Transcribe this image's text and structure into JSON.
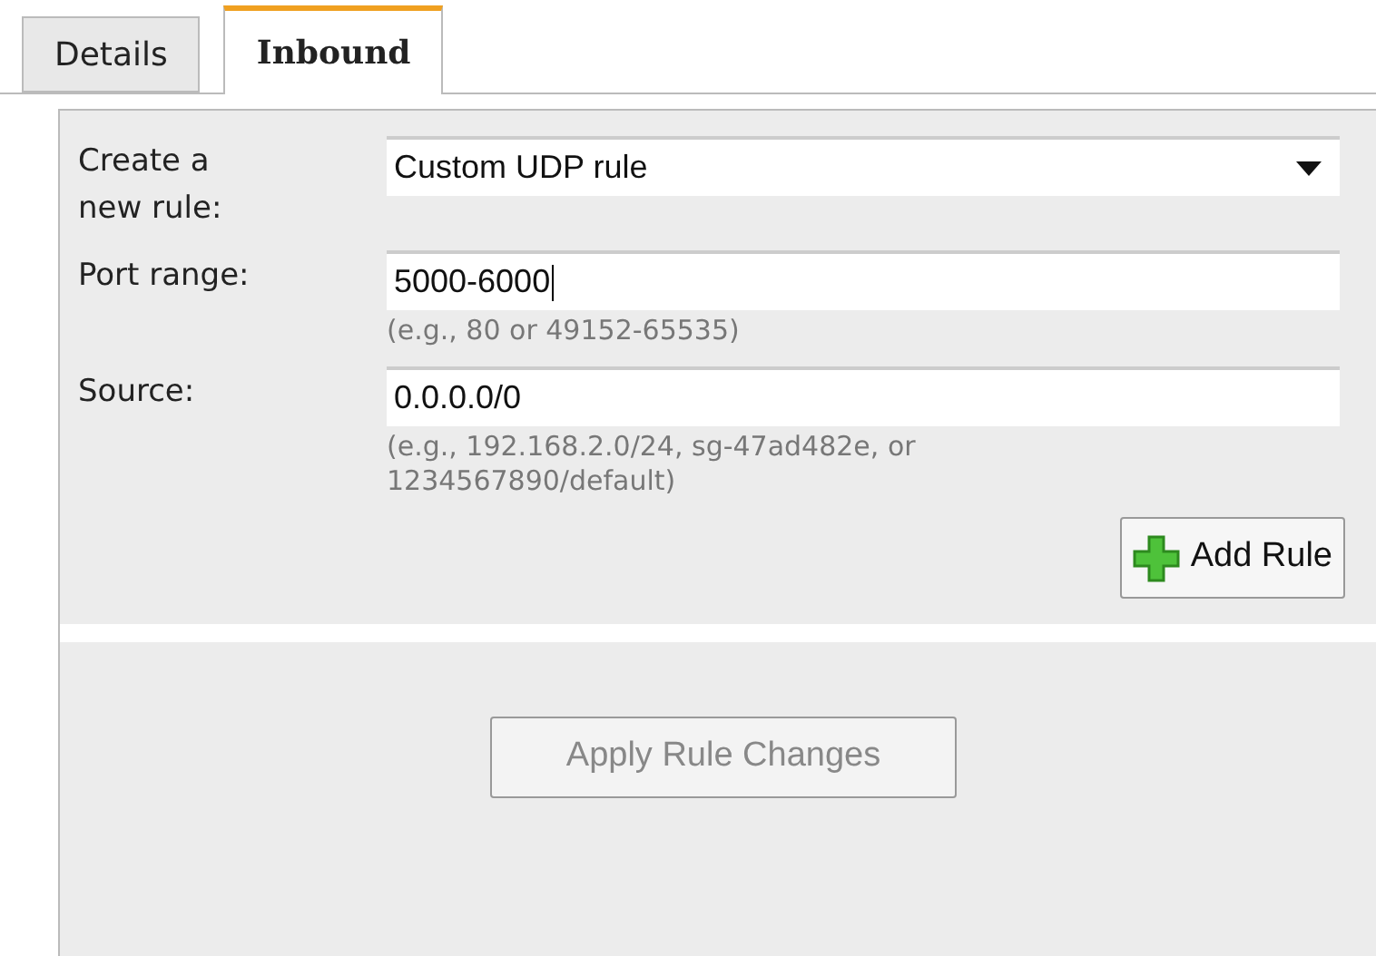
{
  "tabs": [
    {
      "label": "Details",
      "selected": false
    },
    {
      "label": "Inbound",
      "selected": true
    }
  ],
  "fields": [
    {
      "kind": "select",
      "label": "Create a new rule:",
      "value": "Custom UDP rule"
    },
    {
      "kind": "text",
      "label": "Port range:",
      "value": "5000-6000",
      "focused": true,
      "hint": "(e.g., 80 or 49152-65535)"
    },
    {
      "kind": "text",
      "label": "Source:",
      "value": "0.0.0.0/0",
      "hint": "(e.g., 192.168.2.0/24, sg-47ad482e, or 1234567890/default)"
    }
  ],
  "add_button": {
    "label": "Add Rule"
  },
  "apply_button": {
    "label": "Apply Rule Changes",
    "disabled": true
  }
}
